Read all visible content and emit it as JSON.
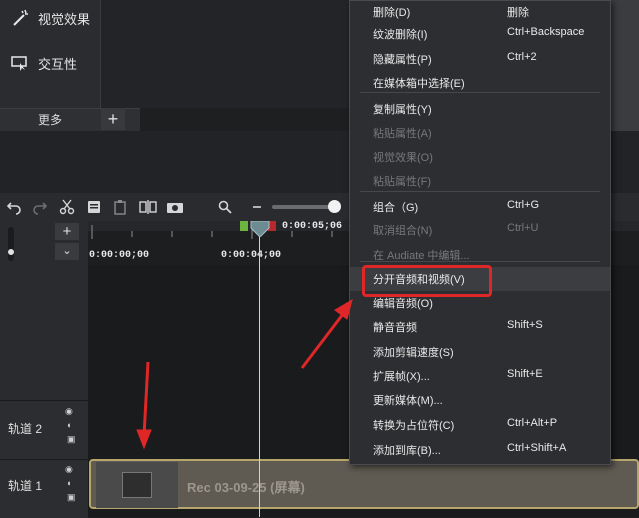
{
  "tools": [
    {
      "label": "视觉效果",
      "icon": "magic-wand-icon"
    },
    {
      "label": "交互性",
      "icon": "interactive-cursor-icon"
    }
  ],
  "more_label": "更多",
  "add_label": "+",
  "playhead_time": "0:00:05;06",
  "ruler": {
    "t0": "0:00:00;00",
    "t1": "0:00:04;00"
  },
  "tracks": [
    {
      "label": "轨道 2"
    },
    {
      "label": "轨道 1"
    }
  ],
  "clip_label": "Rec 03-09-25 (屏幕)",
  "context_menu": {
    "items": [
      {
        "label": "删除(D)",
        "shortcut": "删除",
        "disabled": false
      },
      {
        "label": "纹波删除(I)",
        "shortcut": "Ctrl+Backspace",
        "disabled": false
      },
      {
        "label": "隐藏属性(P)",
        "shortcut": "Ctrl+2",
        "disabled": false
      },
      {
        "label": "在媒体箱中选择(E)",
        "shortcut": "",
        "disabled": false
      },
      {
        "label": "复制属性(Y)",
        "shortcut": "",
        "disabled": false
      },
      {
        "label": "粘贴属性(A)",
        "shortcut": "",
        "disabled": true
      },
      {
        "label": "视觉效果(O)",
        "shortcut": "",
        "disabled": true
      },
      {
        "label": "粘贴属性(F)",
        "shortcut": "",
        "disabled": true
      },
      {
        "label": "组合（G)",
        "shortcut": "Ctrl+G",
        "disabled": false
      },
      {
        "label": "取消组合(N)",
        "shortcut": "Ctrl+U",
        "disabled": true
      },
      {
        "label": "在 Audiate 中编辑...",
        "shortcut": "",
        "disabled": true
      },
      {
        "label": "分开音频和视频(V)",
        "shortcut": "",
        "disabled": false,
        "highlighted": true
      },
      {
        "label": "编辑音频(O)",
        "shortcut": "",
        "disabled": false
      },
      {
        "label": "静音音频",
        "shortcut": "Shift+S",
        "disabled": false
      },
      {
        "label": "添加剪辑速度(S)",
        "shortcut": "",
        "disabled": false
      },
      {
        "label": "扩展帧(X)...",
        "shortcut": "Shift+E",
        "disabled": false
      },
      {
        "label": "更新媒体(M)...",
        "shortcut": "",
        "disabled": false
      },
      {
        "label": "转换为占位符(C)",
        "shortcut": "Ctrl+Alt+P",
        "disabled": false
      },
      {
        "label": "添加到库(B)...",
        "shortcut": "Ctrl+Shift+A",
        "disabled": false
      }
    ]
  },
  "colors": {
    "annotation_red": "#e02727",
    "clip_border": "#b8a76c"
  }
}
